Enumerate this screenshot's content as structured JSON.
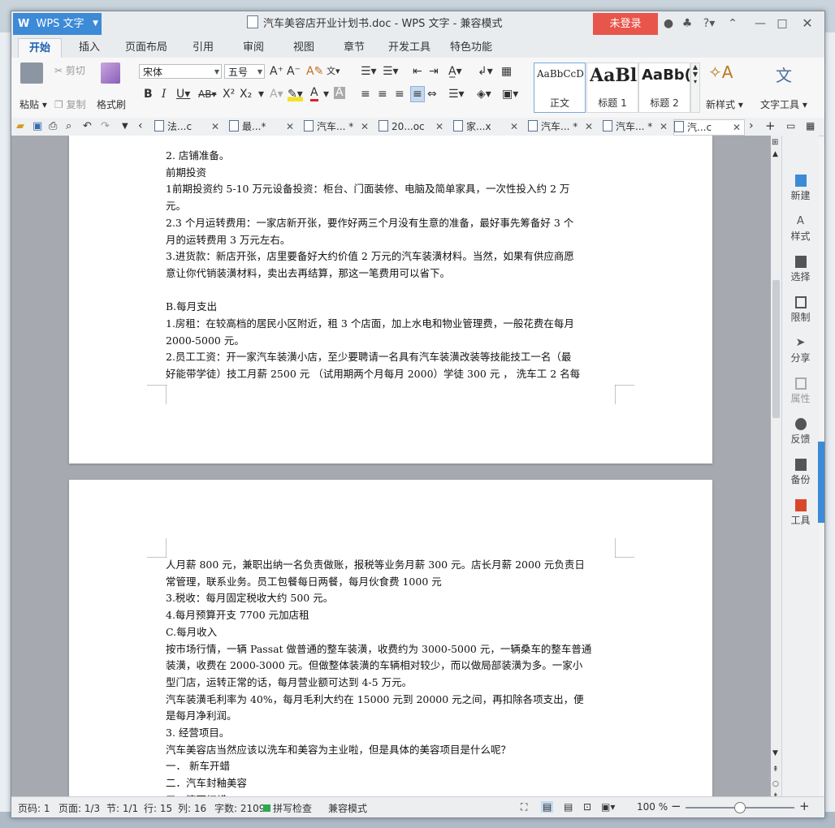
{
  "app": {
    "brand": "WPS 文字",
    "document_title": "汽车美容店开业计划书.doc - WPS 文字 - 兼容模式",
    "login_label": "未登录",
    "help_label": "?"
  },
  "ribbon_tabs": [
    "开始",
    "插入",
    "页面布局",
    "引用",
    "审阅",
    "视图",
    "章节",
    "开发工具",
    "特色功能"
  ],
  "ribbon": {
    "paste": "粘贴",
    "cut": "剪切",
    "copy": "复制",
    "format_painter": "格式刷",
    "font_name": "宋体",
    "font_size": "五号",
    "styles": [
      {
        "sample": "AaBbCcD",
        "caption": "正文"
      },
      {
        "sample": "AaBl",
        "caption": "标题 1"
      },
      {
        "sample": "AaBb(",
        "caption": "标题 2"
      }
    ],
    "new_style": "新样式",
    "text_tools": "文字工具"
  },
  "doc_tabs": [
    {
      "label": "法...c",
      "active": false
    },
    {
      "label": "最...*",
      "active": false
    },
    {
      "label": "汽车... *",
      "active": false
    },
    {
      "label": "20...oc",
      "active": false
    },
    {
      "label": "家...x",
      "active": false
    },
    {
      "label": "汽车... *",
      "active": false
    },
    {
      "label": "汽车... *",
      "active": false
    },
    {
      "label": "汽...c",
      "active": true
    }
  ],
  "page1_lines": [
    "2. 店铺准备。",
    "前期投资",
    "1前期投资约 5-10 万元设备投资：柜台、门面装修、电脑及简单家具，一次性投入约 2 万",
    "元。",
    "2.3 个月运转费用：一家店新开张，要作好两三个月没有生意的准备，最好事先筹备好 3 个",
    "月的运转费用 3 万元左右。",
    "3.进货款：新店开张，店里要备好大约价值 2 万元的汽车装潢材料。当然，如果有供应商愿",
    "意让你代销装潢材料，卖出去再结算，那这一笔费用可以省下。",
    "",
    "B.每月支出",
    "1.房租：在较高档的居民小区附近，租 3 个店面，加上水电和物业管理费，一般花费在每月",
    "2000-5000 元。",
    "2.员工工资：开一家汽车装潢小店，至少要聘请一名具有汽车装潢改装等技能技工一名（最",
    "好能带学徒）技工月薪 2500 元 （试用期两个月每月 2000）学徒 300 元 ， 洗车工 2 名每"
  ],
  "page2_lines": [
    "人月薪 800 元，兼职出纳一名负责做账，报税等业务月薪 300 元。店长月薪 2000 元负责日",
    "常管理，联系业务。员工包餐每日两餐，每月伙食费 1000 元",
    "3.税收：每月固定税收大约 500 元。",
    "4.每月预算开支  7700 元加店租",
    "C.每月收入",
    "按市场行情，一辆 Passat 做普通的整车装潢，收费约为 3000-5000 元，一辆桑车的整车普通",
    "装潢，收费在 2000-3000 元。但做整体装潢的车辆相对较少，而以做局部装潢为多。一家小",
    "型门店，运转正常的话，每月营业额可达到 4-5 万元。",
    "汽车装潢毛利率为 40%，每月毛利大约在 15000 元到 20000 元之间，再扣除各项支出，便",
    "是每月净利润。",
    "3. 经营项目。",
    "汽车美容店当然应该以洗车和美容为主业啦，但是具体的美容项目是什么呢？",
    "一．   新车开蜡",
    "二．汽车封釉美容",
    "三．漆面打蜡"
  ],
  "right_panel": [
    "新建",
    "样式",
    "选择",
    "限制",
    "分享",
    "属性",
    "反馈",
    "备份",
    "工具"
  ],
  "status": {
    "page_code": "页码: 1",
    "pages": "页面: 1/3",
    "section": "节: 1/1",
    "row": "行: 15",
    "col": "列: 16",
    "word_count": "字数: 2109",
    "spell_check": "拼写检查",
    "compat_mode": "兼容模式",
    "zoom": "100 %",
    "zoom_level": 0.5
  },
  "colors": {
    "accent": "#3d8ad6",
    "login": "#e8554a"
  }
}
